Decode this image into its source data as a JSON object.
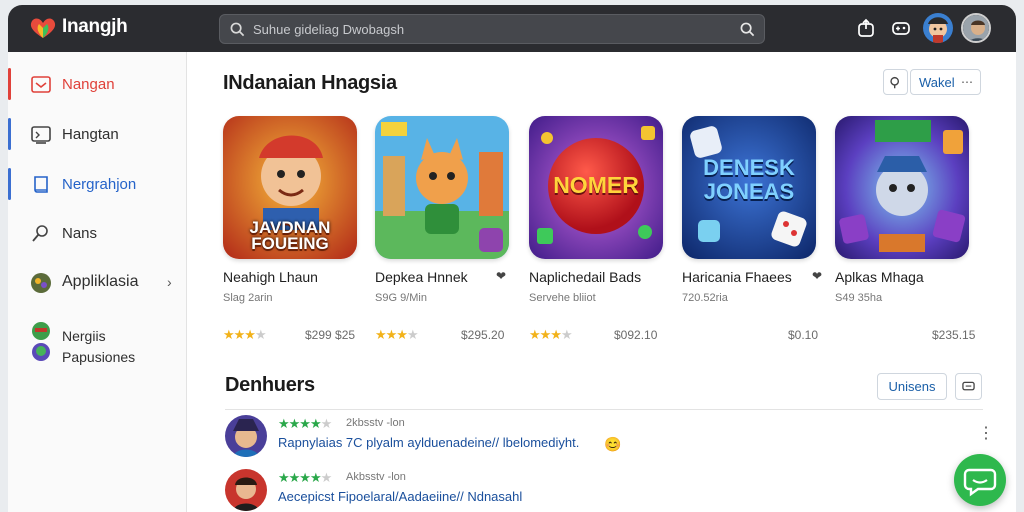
{
  "app": {
    "brand": "Inangjh",
    "search_placeholder": "Suhue gideliag Dwobagsh"
  },
  "sidebar": {
    "items": [
      {
        "label": "Nangan",
        "active": true,
        "accent": "#e0413a"
      },
      {
        "label": "Hangtan"
      },
      {
        "label": "Nergrahjon",
        "accent": "#2563c9"
      },
      {
        "label": "Nans"
      },
      {
        "label": "Appliklasia",
        "has_chevron": true
      },
      {
        "label": "Nergiis"
      },
      {
        "label": "Papusiones"
      }
    ]
  },
  "featured": {
    "title": "INdanaian Hnagsia",
    "filter_label": "Wakel",
    "apps": [
      {
        "name": "Neahigh Lhaun",
        "sub": "Slag 2arin",
        "rating": 3,
        "price": "$299 $25",
        "tile_text": "JAVDNAN FOUEING",
        "tile_bg": "#c9421f"
      },
      {
        "name": "Depkea Hnnek",
        "sub": "S9G 9/Min",
        "rating": 3,
        "price": "$295.20",
        "tile_text": "",
        "tile_bg": "#4aa3d8"
      },
      {
        "name": "Naplichedail Bads",
        "sub": "Servehe bliiot",
        "rating": 3,
        "price": "$092.10",
        "tile_text": "NOMER",
        "tile_bg": "#7a3fb8"
      },
      {
        "name": "Haricania Fhaees",
        "sub": "720.52ria",
        "rating": 0,
        "price": "$0.10",
        "tile_text": "DENESK JONEAS",
        "tile_bg": "#1b46a8"
      },
      {
        "name": "Aplkas Mhaga",
        "sub": "S49 35ha",
        "rating": 0,
        "price": "$235.15",
        "tile_text": "",
        "tile_bg": "#3b2fa0"
      }
    ]
  },
  "reviews": {
    "title": "Denhuers",
    "action_label": "Unisens",
    "items": [
      {
        "rating": 4,
        "meta": "2kbsstv -lon",
        "text": "Rapnylaias 7C plyalm aylduenadeine// lbelomediyht."
      },
      {
        "rating": 4,
        "meta": "Akbsstv -lon",
        "text": "Aecepicst Fipoelaral/Aadaeiine// Ndnasahl"
      }
    ]
  }
}
